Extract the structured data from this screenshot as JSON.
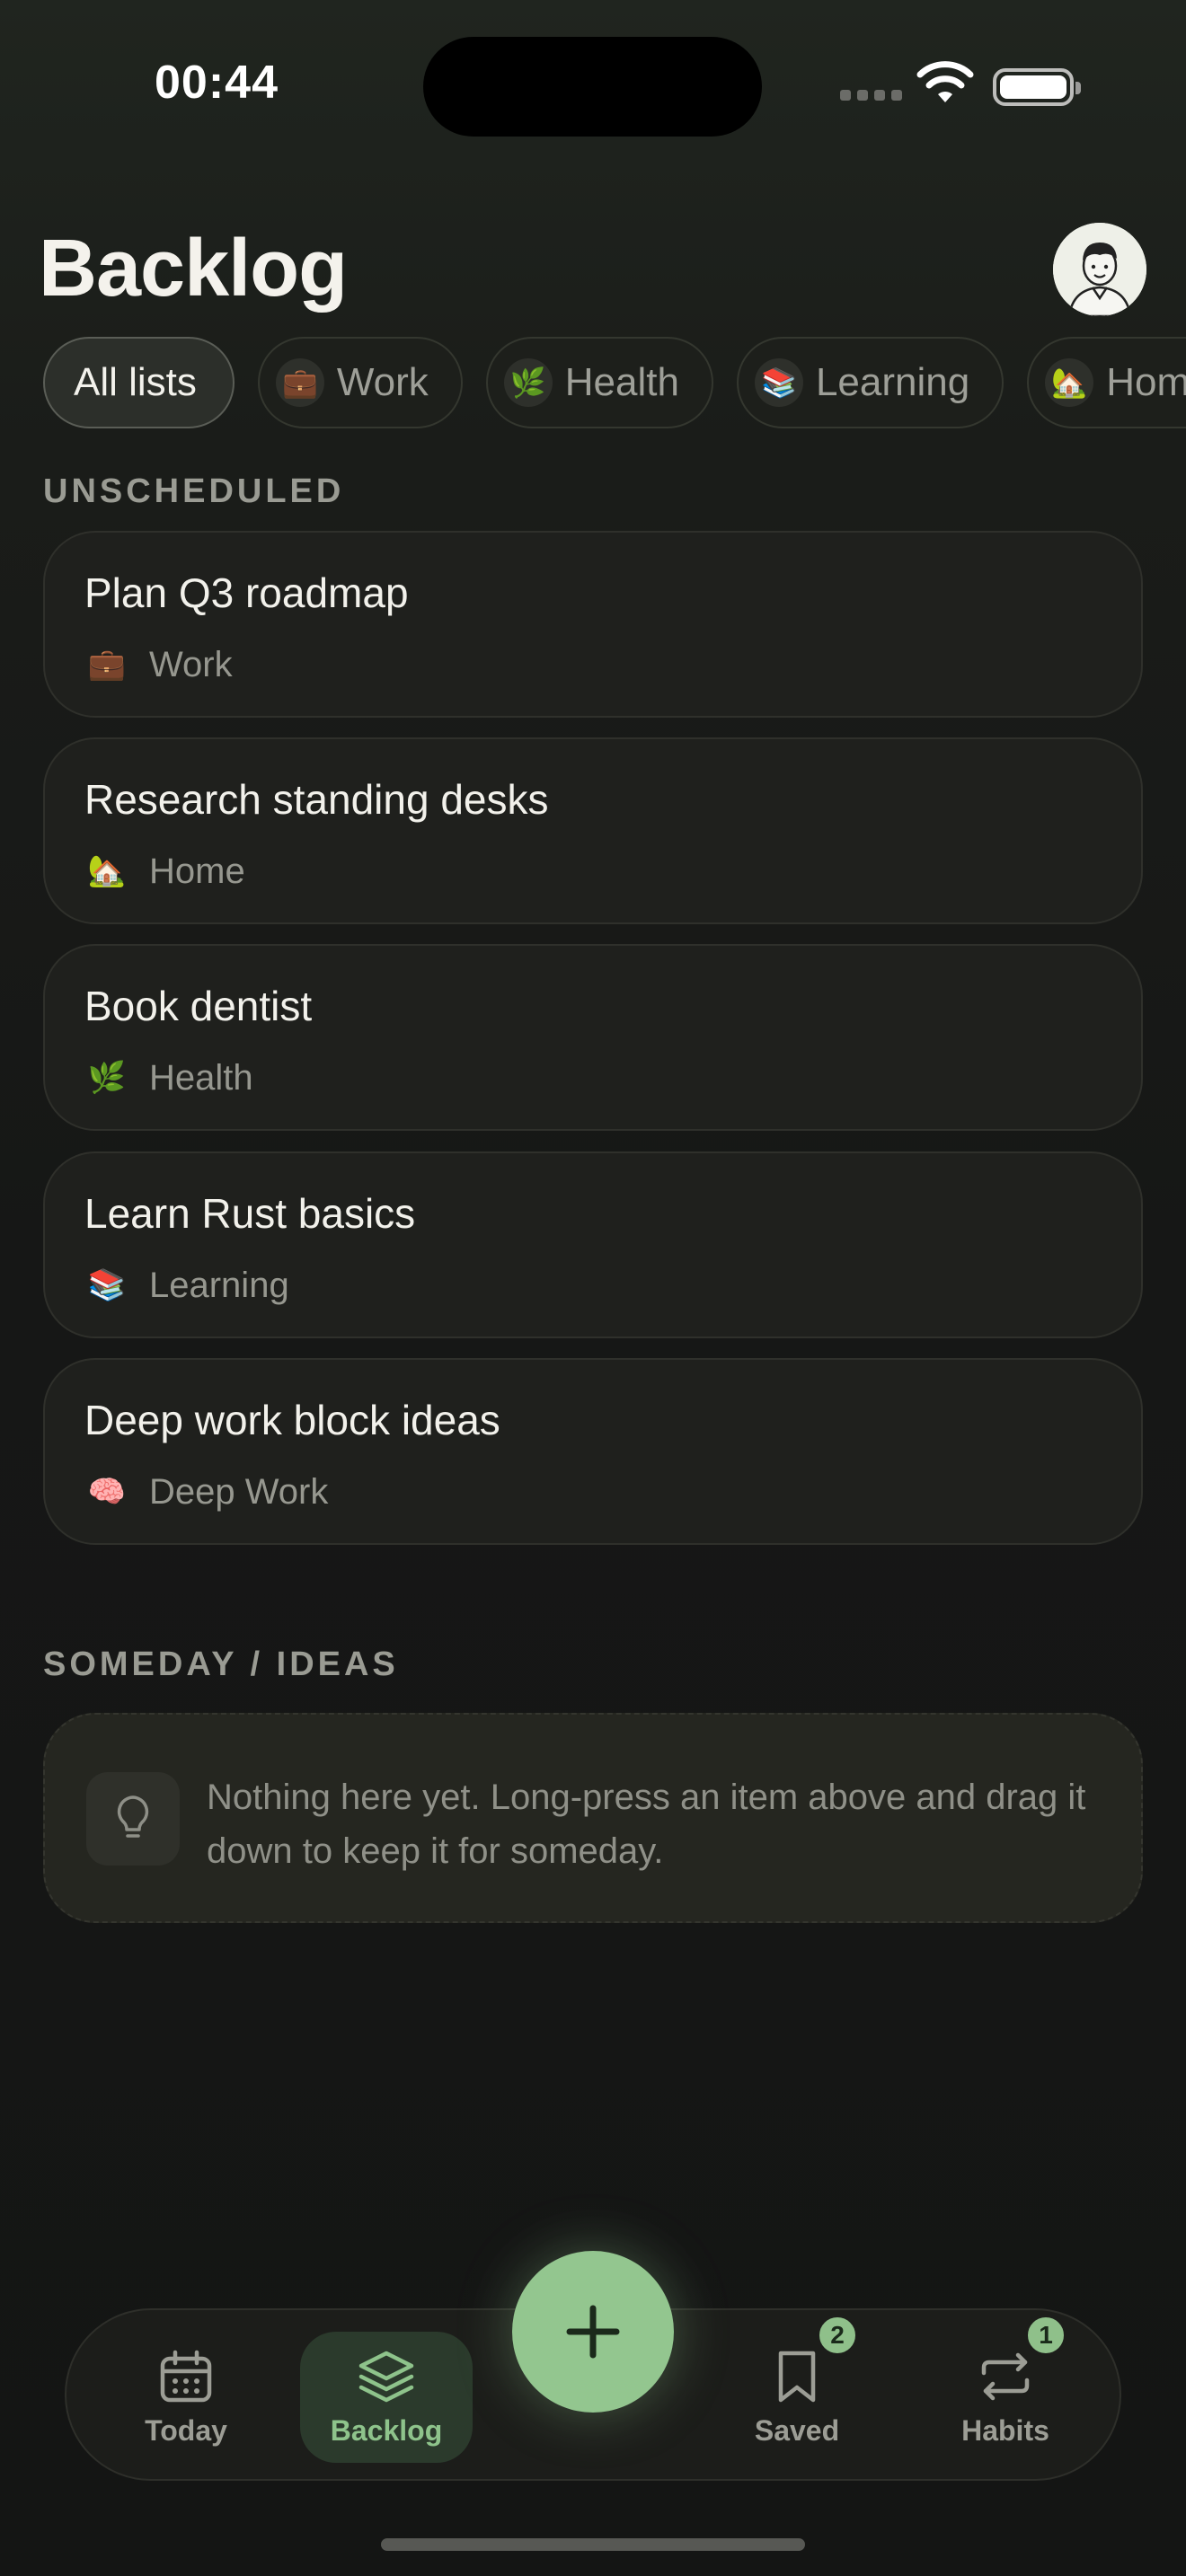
{
  "status_bar": {
    "time": "00:44"
  },
  "header": {
    "title": "Backlog"
  },
  "filters": [
    {
      "label": "All lists",
      "emoji": "",
      "active": true
    },
    {
      "label": "Work",
      "emoji": "💼",
      "active": false
    },
    {
      "label": "Health",
      "emoji": "🌿",
      "active": false
    },
    {
      "label": "Learning",
      "emoji": "📚",
      "active": false
    },
    {
      "label": "Home",
      "emoji": "🏡",
      "active": false
    }
  ],
  "unscheduled": {
    "label": "UNSCHEDULED",
    "items": [
      {
        "title": "Plan Q3 roadmap",
        "list": "Work",
        "emoji": "💼"
      },
      {
        "title": "Research standing desks",
        "list": "Home",
        "emoji": "🏡"
      },
      {
        "title": "Book dentist",
        "list": "Health",
        "emoji": "🌿"
      },
      {
        "title": "Learn Rust basics",
        "list": "Learning",
        "emoji": "📚"
      },
      {
        "title": "Deep work block ideas",
        "list": "Deep Work",
        "emoji": "🧠"
      }
    ]
  },
  "someday": {
    "label": "SOMEDAY / IDEAS",
    "empty_text": "Nothing here yet. Long-press an item above and drag it down to keep it for someday."
  },
  "tabbar": {
    "today": "Today",
    "backlog": "Backlog",
    "saved": "Saved",
    "saved_badge": "2",
    "habits": "Habits",
    "habits_badge": "1"
  },
  "colors": {
    "accent": "#93c68f",
    "background": "#161716"
  }
}
